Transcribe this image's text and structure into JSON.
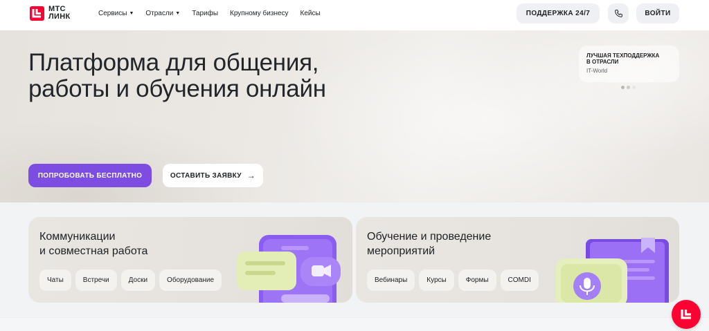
{
  "header": {
    "logo_line1": "МТС",
    "logo_line2": "ЛИНК",
    "nav": [
      {
        "label": "Сервисы",
        "has_caret": true
      },
      {
        "label": "Отрасли",
        "has_caret": true
      },
      {
        "label": "Тарифы",
        "has_caret": false
      },
      {
        "label": "Крупному бизнесу",
        "has_caret": false
      },
      {
        "label": "Кейсы",
        "has_caret": false
      }
    ],
    "support_label": "ПОДДЕРЖКА 24/7",
    "phone_icon": "phone-icon",
    "login_label": "ВОЙТИ"
  },
  "hero": {
    "title_line1": "Платформа для общения,",
    "title_line2": "работы и обучения онлайн",
    "try_label": "ПОПРОБОВАТЬ БЕСПЛАТНО",
    "request_label": "ОСТАВИТЬ ЗАЯВКУ",
    "request_arrow": "→",
    "award": {
      "title_line1": "ЛУЧШАЯ ТЕХПОДДЕРЖКА",
      "title_line2": "В ОТРАСЛИ",
      "source": "IT-World"
    },
    "carousel_dots": 3
  },
  "cards": [
    {
      "title_line1": "Коммуникации",
      "title_line2": "и совместная работа",
      "chips": [
        "Чаты",
        "Встречи",
        "Доски",
        "Оборудование"
      ]
    },
    {
      "title_line1": "Обучение и проведение",
      "title_line2": "мероприятий",
      "chips": [
        "Вебинары",
        "Курсы",
        "Формы",
        "COMDI"
      ]
    }
  ],
  "colors": {
    "accent_purple": "#7d4ce0",
    "brand_red": "#ff0032",
    "text_dark": "#1d2023"
  }
}
